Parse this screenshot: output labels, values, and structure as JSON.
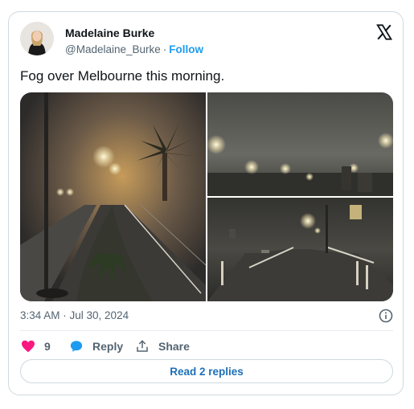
{
  "author": {
    "name": "Madelaine Burke",
    "handle": "@Madelaine_Burke",
    "separator": "·",
    "follow_label": "Follow"
  },
  "tweet": {
    "text": "Fog over Melbourne this morning.",
    "timestamp": "3:34 AM · Jul 30, 2024"
  },
  "actions": {
    "like_count": "9",
    "reply_label": "Reply",
    "share_label": "Share",
    "read_replies_label": "Read 2 replies"
  },
  "colors": {
    "like": "#f91880",
    "reply": "#1d9bf0",
    "follow": "#1d9bf0",
    "muted": "#536471"
  },
  "icons": [
    "x-logo-icon",
    "info-icon",
    "heart-icon",
    "speech-bubble-icon",
    "share-icon"
  ]
}
